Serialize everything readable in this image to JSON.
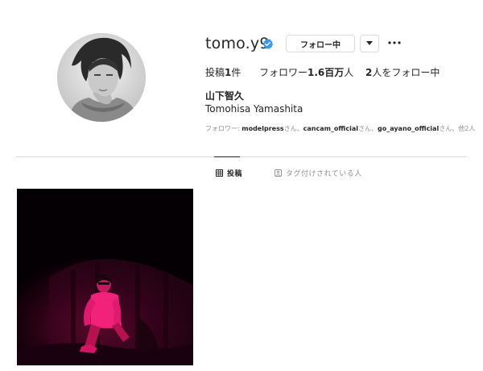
{
  "profile": {
    "username": "tomo.y9",
    "verified": true,
    "follow_button_label": "フォロー中",
    "stats": {
      "posts_label": "投稿",
      "posts_count": "1",
      "posts_unit": "件",
      "followers_label": "フォロワー",
      "followers_count": "1.6百万",
      "followers_unit": "人",
      "following_count": "2",
      "following_suffix": "人をフォロー中"
    },
    "full_name": "山下智久",
    "bio": "Tomohisa Yamashita",
    "followed_by": {
      "prefix": "フォロワー: ",
      "users": [
        "modelpress",
        "cancam_official",
        "go_ayano_official"
      ],
      "honorific": "さん",
      "separator": "、",
      "suffix": "他2人"
    }
  },
  "tabs": [
    {
      "label": "投稿",
      "icon": "grid-icon",
      "active": true
    },
    {
      "label": "タグ付けされている人",
      "icon": "tag-person-icon",
      "active": false
    }
  ],
  "colors": {
    "text": "#262626",
    "muted": "#8e8e8e",
    "border": "#dbdbdb",
    "verified": "#3897f0",
    "post_accent": "#e0106a"
  }
}
